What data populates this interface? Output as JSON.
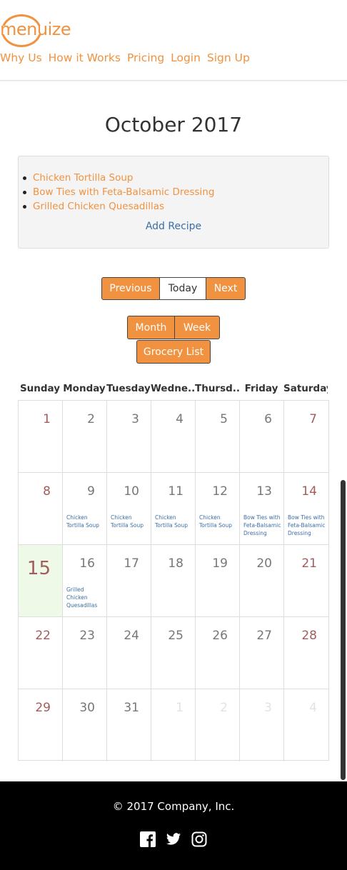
{
  "brand": {
    "logo_text": "menuize"
  },
  "nav": [
    "Why Us",
    "How it Works",
    "Pricing",
    "Login",
    "Sign Up"
  ],
  "calendar": {
    "title": "October 2017",
    "recipes": [
      "Chicken Tortilla Soup",
      "Bow Ties with Feta-Balsamic Dressing",
      "Grilled Chicken Quesadillas"
    ],
    "add_recipe": "Add Recipe",
    "nav_buttons": {
      "previous": "Previous",
      "today": "Today",
      "next": "Next"
    },
    "view_buttons": {
      "month": "Month",
      "week": "Week"
    },
    "grocery": "Grocery List",
    "days": [
      "Sunday",
      "Monday",
      "Tuesday",
      "Wedne...",
      "Thursd...",
      "Friday",
      "Saturday"
    ],
    "weeks": [
      [
        {
          "n": "1",
          "t": "we"
        },
        {
          "n": "2"
        },
        {
          "n": "3"
        },
        {
          "n": "4"
        },
        {
          "n": "5"
        },
        {
          "n": "6"
        },
        {
          "n": "7",
          "t": "we"
        }
      ],
      [
        {
          "n": "8",
          "t": "we"
        },
        {
          "n": "9",
          "e": "Chicken Tortilla Soup"
        },
        {
          "n": "10",
          "e": "Chicken Tortilla Soup"
        },
        {
          "n": "11",
          "e": "Chicken Tortilla Soup"
        },
        {
          "n": "12",
          "e": "Chicken Tortilla Soup"
        },
        {
          "n": "13",
          "e": "Bow Ties with Feta-Balsamic Dressing"
        },
        {
          "n": "14",
          "t": "we",
          "e": "Bow Ties with Feta-Balsamic Dressing"
        }
      ],
      [
        {
          "n": "15",
          "t": "today"
        },
        {
          "n": "16",
          "e": "Grilled Chicken Quesadillas"
        },
        {
          "n": "17"
        },
        {
          "n": "18"
        },
        {
          "n": "19"
        },
        {
          "n": "20"
        },
        {
          "n": "21",
          "t": "we"
        }
      ],
      [
        {
          "n": "22",
          "t": "we"
        },
        {
          "n": "23"
        },
        {
          "n": "24"
        },
        {
          "n": "25"
        },
        {
          "n": "26"
        },
        {
          "n": "27"
        },
        {
          "n": "28",
          "t": "we"
        }
      ],
      [
        {
          "n": "29",
          "t": "we"
        },
        {
          "n": "30"
        },
        {
          "n": "31"
        },
        {
          "n": "1",
          "t": "other"
        },
        {
          "n": "2",
          "t": "other"
        },
        {
          "n": "3",
          "t": "other"
        },
        {
          "n": "4",
          "t": "other"
        }
      ]
    ]
  },
  "footer": {
    "copyright": "© 2017 Company, Inc.",
    "social": [
      "facebook-icon",
      "twitter-icon",
      "instagram-icon"
    ]
  },
  "colors": {
    "accent": "#f0923f",
    "link": "#3a6ea5",
    "weekend": "#a35c5c",
    "today_bg": "#eef9e8",
    "footer_bg": "#000000"
  }
}
